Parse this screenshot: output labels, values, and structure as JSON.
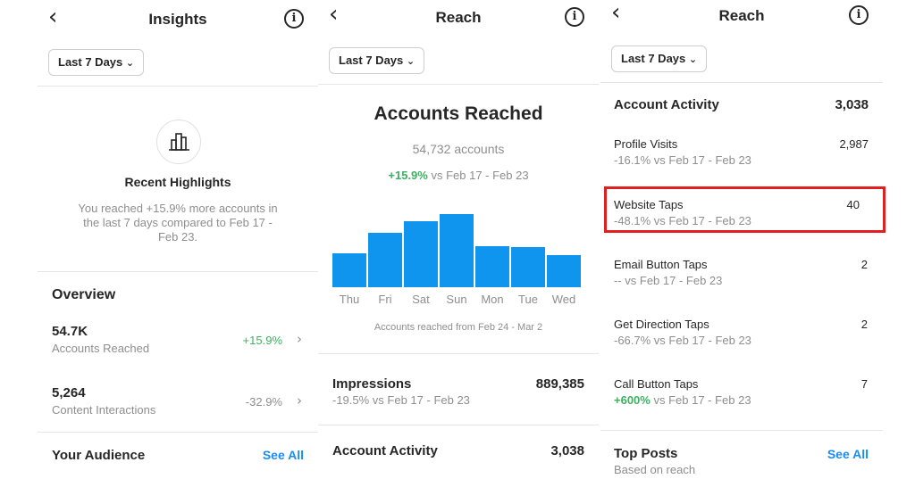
{
  "panels": [
    {
      "title": "Insights",
      "date_filter": "Last 7 Days",
      "highlights": {
        "title": "Recent Highlights",
        "text_lines": [
          "You reached +15.9% more accounts in",
          "the last 7 days compared to Feb 17 -",
          "Feb 23."
        ]
      },
      "overview": {
        "title": "Overview",
        "items": [
          {
            "value": "54.7K",
            "label": "Accounts Reached",
            "change": "+15.9%"
          },
          {
            "value": "5,264",
            "label": "Content Interactions",
            "change": "-32.9%"
          }
        ]
      },
      "audience": {
        "title": "Your Audience",
        "link": "See All"
      }
    },
    {
      "title": "Reach",
      "date_filter": "Last 7 Days",
      "accounts_reached": {
        "title": "Accounts Reached",
        "count": "54,732 accounts",
        "change": "+15.9%",
        "compare": "vs Feb 17 - Feb 23",
        "caption": "Accounts reached from Feb 24 - Mar 2"
      },
      "impressions": {
        "label": "Impressions",
        "value": "889,385",
        "change": "-19.5% vs Feb 17 - Feb 23"
      },
      "account_activity": {
        "label": "Account Activity",
        "value": "3,038"
      }
    },
    {
      "title": "Reach",
      "date_filter": "Last 7 Days",
      "account_activity": {
        "label": "Account Activity",
        "value": "3,038"
      },
      "items": [
        {
          "label": "Profile Visits",
          "value": "2,987",
          "change": "-16.1% vs Feb 17 - Feb 23"
        },
        {
          "label": "Website Taps",
          "value": "40",
          "change": "-48.1% vs Feb 17 - Feb 23"
        },
        {
          "label": "Email Button Taps",
          "value": "2",
          "change": "-- vs Feb 17 - Feb 23"
        },
        {
          "label": "Get Direction Taps",
          "value": "2",
          "change": "-66.7% vs Feb 17 - Feb 23"
        },
        {
          "label": "Call Button Taps",
          "value": "7",
          "change_highlight": "+600%",
          "change_rest": "vs Feb 17 - Feb 23"
        }
      ],
      "top_posts": {
        "title": "Top Posts",
        "subtitle": "Based on reach",
        "link": "See All"
      }
    }
  ],
  "colors": {
    "bar": "#1095ee",
    "positive": "#3db05f",
    "link": "#1a8df2",
    "highlight_box": "#e02020"
  },
  "chart_data": {
    "type": "bar",
    "categories": [
      "Thu",
      "Fri",
      "Sat",
      "Sun",
      "Mon",
      "Tue",
      "Wed"
    ],
    "values": [
      33,
      53,
      64,
      71,
      40,
      39,
      31
    ]
  }
}
